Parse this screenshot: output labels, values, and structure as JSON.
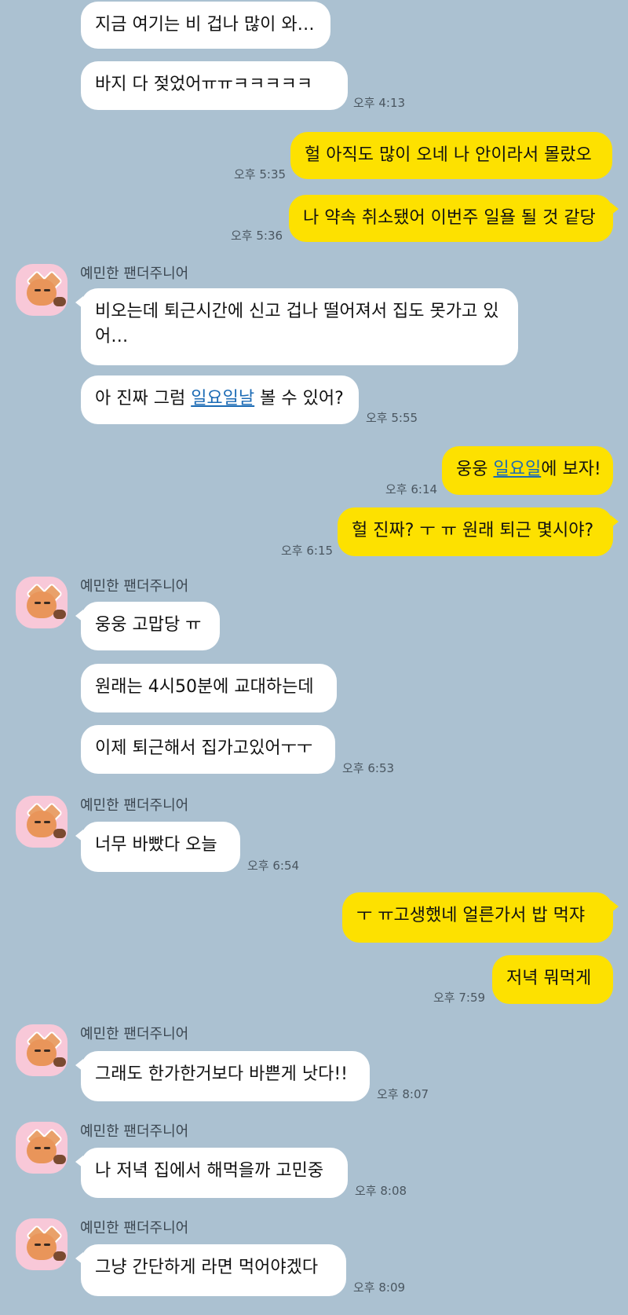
{
  "sender_name": "예민한 팬더주니어",
  "messages": {
    "m1": "지금 여기는 비 겁나 많이 와…",
    "m2": "바지 다 젖었어ㅠㅠㅋㅋㅋㅋㅋ",
    "t2": "오후 4:13",
    "m3": "헐 아직도 많이 오네 나 안이라서 몰랐오",
    "t3": "오후 5:35",
    "m4": "나 약속 취소됐어 이번주 일욜 될 것 같당",
    "t4": "오후 5:36",
    "m5": "비오는데 퇴근시간에 신고 겁나 떨어져서 집도 못가고 있어…",
    "m6_pre": "아 진짜 그럼 ",
    "m6_link": "일요일날",
    "m6_post": " 볼 수 있어?",
    "t6": "오후 5:55",
    "m7_pre": "웅웅 ",
    "m7_link": "일요일",
    "m7_post": "에 보자!",
    "t7": "오후 6:14",
    "m8": "헐 진짜? ㅜ ㅠ 원래 퇴근 몇시야?",
    "t8": "오후 6:15",
    "m9": "웅웅 고맙당 ㅠ",
    "m10": "원래는 4시50분에 교대하는데",
    "m11": "이제 퇴근해서 집가고있어ㅜㅜ",
    "t11": "오후 6:53",
    "m12": "너무 바빴다 오늘",
    "t12": "오후 6:54",
    "m13": "ㅜ ㅠ고생했네 얼른가서 밥 먹쟈",
    "m14": "저녁 뭐먹게",
    "t14": "오후 7:59",
    "m15": "그래도 한가한거보다 바쁜게 낫다!!",
    "t15": "오후 8:07",
    "m16": "나 저녁 집에서 해먹을까 고민중",
    "t16": "오후 8:08",
    "m17": "그냥 간단하게 라면 먹어야겠다",
    "t17": "오후 8:09"
  },
  "colors": {
    "background": "#abc1d1",
    "my_bubble": "#fde100",
    "their_bubble": "#ffffff",
    "link": "#1c6bb5"
  }
}
